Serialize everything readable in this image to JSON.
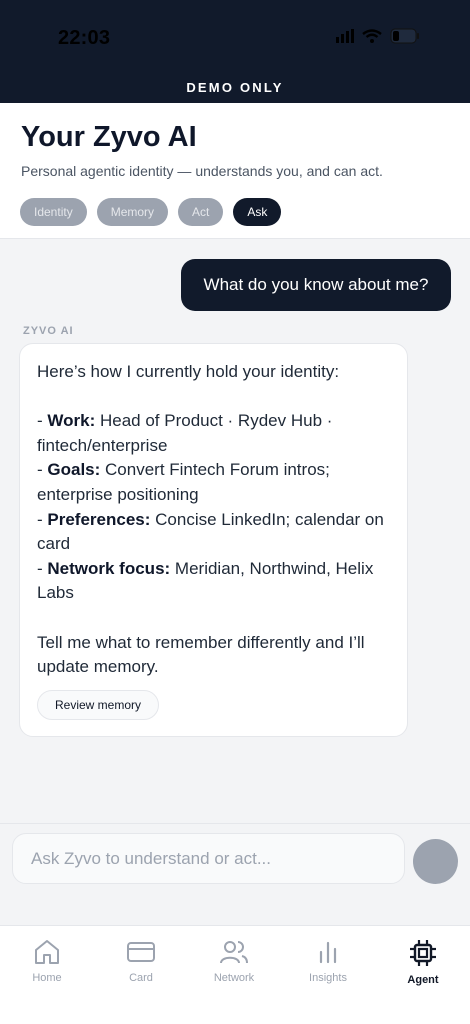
{
  "status_bar": {
    "time": "22:03"
  },
  "banner": {
    "text": "DEMO ONLY"
  },
  "header": {
    "title": "Your Zyvo AI",
    "subtitle": "Personal agentic identity — understands you, and can act.",
    "chips": [
      {
        "label": "Identity",
        "active": false
      },
      {
        "label": "Memory",
        "active": false
      },
      {
        "label": "Act",
        "active": false
      },
      {
        "label": "Ask",
        "active": true
      }
    ]
  },
  "chat": {
    "user_message": "What do you know about me?",
    "sender_label": "ZYVO AI",
    "ai_message": {
      "intro": "Here’s how I currently hold your identity:",
      "items": [
        {
          "key": "Work:",
          "value": " Head of Product · Rydev Hub · fintech/enterprise"
        },
        {
          "key": "Goals:",
          "value": " Convert Fintech Forum intros; enterprise positioning"
        },
        {
          "key": "Preferences:",
          "value": " Concise LinkedIn; calendar on card"
        },
        {
          "key": "Network focus:",
          "value": " Meridian, Northwind, Helix Labs"
        }
      ],
      "outro": "Tell me what to remember differently and I’ll update memory.",
      "action_label": "Review memory"
    }
  },
  "composer": {
    "placeholder": "Ask Zyvo to understand or act..."
  },
  "nav": {
    "items": [
      {
        "label": "Home",
        "icon": "home-icon"
      },
      {
        "label": "Card",
        "icon": "card-icon"
      },
      {
        "label": "Network",
        "icon": "people-icon"
      },
      {
        "label": "Insights",
        "icon": "bar-chart-icon"
      },
      {
        "label": "Agent",
        "icon": "chip-icon",
        "active": true
      }
    ]
  },
  "colors": {
    "primary": "#111a2b",
    "muted_chip": "#9ca3af",
    "background": "#f3f4f6"
  }
}
